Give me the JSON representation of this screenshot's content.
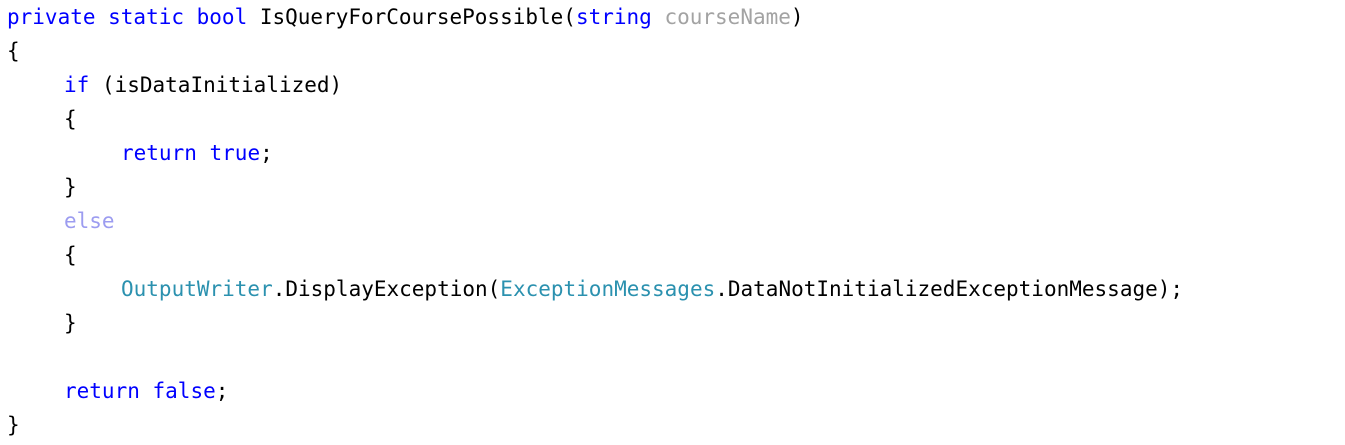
{
  "editor": {
    "colors": {
      "background": "#ffffff",
      "plain": "#000000",
      "keyword": "#0000ff",
      "type_name": "#2b91af",
      "unused_parameter": "#a3a3a3",
      "dimmed_keyword": "#9c9cf0"
    },
    "lines": [
      {
        "indent": 0,
        "tokens": [
          {
            "text": "private static bool",
            "kind": "keyword"
          },
          {
            "text": " IsQueryForCoursePossible(",
            "kind": "plain"
          },
          {
            "text": "string",
            "kind": "keyword"
          },
          {
            "text": " ",
            "kind": "plain"
          },
          {
            "text": "courseName",
            "kind": "unused_parameter"
          },
          {
            "text": ")",
            "kind": "plain"
          }
        ]
      },
      {
        "indent": 0,
        "tokens": [
          {
            "text": "{",
            "kind": "plain"
          }
        ]
      },
      {
        "indent": 1,
        "tokens": [
          {
            "text": "if",
            "kind": "keyword"
          },
          {
            "text": " (isDataInitialized)",
            "kind": "plain"
          }
        ]
      },
      {
        "indent": 1,
        "tokens": [
          {
            "text": "{",
            "kind": "plain"
          }
        ]
      },
      {
        "indent": 2,
        "tokens": [
          {
            "text": "return",
            "kind": "keyword"
          },
          {
            "text": " ",
            "kind": "plain"
          },
          {
            "text": "true",
            "kind": "keyword"
          },
          {
            "text": ";",
            "kind": "plain"
          }
        ]
      },
      {
        "indent": 1,
        "tokens": [
          {
            "text": "}",
            "kind": "plain"
          }
        ]
      },
      {
        "indent": 1,
        "tokens": [
          {
            "text": "else",
            "kind": "dimmed_keyword"
          }
        ]
      },
      {
        "indent": 1,
        "tokens": [
          {
            "text": "{",
            "kind": "plain"
          }
        ]
      },
      {
        "indent": 2,
        "tokens": [
          {
            "text": "OutputWriter",
            "kind": "type_name"
          },
          {
            "text": ".DisplayException(",
            "kind": "plain"
          },
          {
            "text": "ExceptionMessages",
            "kind": "type_name"
          },
          {
            "text": ".DataNotInitializedExceptionMessage);",
            "kind": "plain"
          }
        ]
      },
      {
        "indent": 1,
        "tokens": [
          {
            "text": "}",
            "kind": "plain"
          }
        ]
      },
      {
        "indent": 0,
        "tokens": []
      },
      {
        "indent": 1,
        "tokens": [
          {
            "text": "return",
            "kind": "keyword"
          },
          {
            "text": " ",
            "kind": "plain"
          },
          {
            "text": "false",
            "kind": "keyword"
          },
          {
            "text": ";",
            "kind": "plain"
          }
        ]
      },
      {
        "indent": 0,
        "tokens": [
          {
            "text": "}",
            "kind": "plain"
          }
        ]
      }
    ]
  }
}
